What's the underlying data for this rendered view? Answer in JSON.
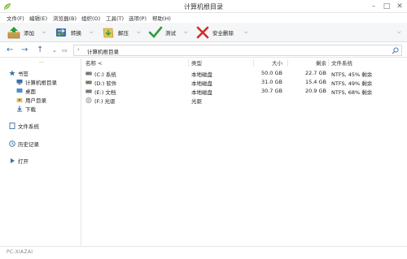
{
  "window": {
    "title": "计算机根目录"
  },
  "menu": [
    "文件(F)",
    "编辑(E)",
    "浏览器(B)",
    "组织(O)",
    "工具(T)",
    "选项(P)",
    "帮助(H)"
  ],
  "toolbar": {
    "add": "添加",
    "convert": "转换",
    "extract": "解压",
    "test": "测试",
    "secure_delete": "安全删除"
  },
  "address": {
    "path": "计算机根目录"
  },
  "sidebar": {
    "dots": "...",
    "bookmarks": "书签",
    "items": [
      "计算机根目录",
      "桌面",
      "用户目录",
      "下载"
    ],
    "file_system": "文件系统",
    "history": "历史记录",
    "open": "打开"
  },
  "table": {
    "headers": {
      "name": "名称 <",
      "type": "类型",
      "size": "大小",
      "free": "剩余",
      "fs": "文件系统"
    },
    "rows": [
      {
        "name": "(C:) 系统",
        "type": "本地磁盘",
        "size": "50.0 GB",
        "free": "22.7 GB",
        "fs": "NTFS, 45% 剩余",
        "icon": "hdd-icon"
      },
      {
        "name": "(D:) 软件",
        "type": "本地磁盘",
        "size": "31.0 GB",
        "free": "15.4 GB",
        "fs": "NTFS, 49% 剩余",
        "icon": "hdd-icon"
      },
      {
        "name": "(E:) 文档",
        "type": "本地磁盘",
        "size": "30.7 GB",
        "free": "20.9 GB",
        "fs": "NTFS, 68% 剩余",
        "icon": "hdd-icon"
      },
      {
        "name": "(F:) 光驱",
        "type": "光驱",
        "size": "",
        "free": "",
        "fs": "",
        "icon": "optical-drive-icon"
      }
    ]
  },
  "status": {
    "watermark": "PC-XIAZAI"
  },
  "colors": {
    "accent": "#3a6ea5",
    "add_green": "#2e9c3a",
    "delete_red": "#d62b2b"
  }
}
